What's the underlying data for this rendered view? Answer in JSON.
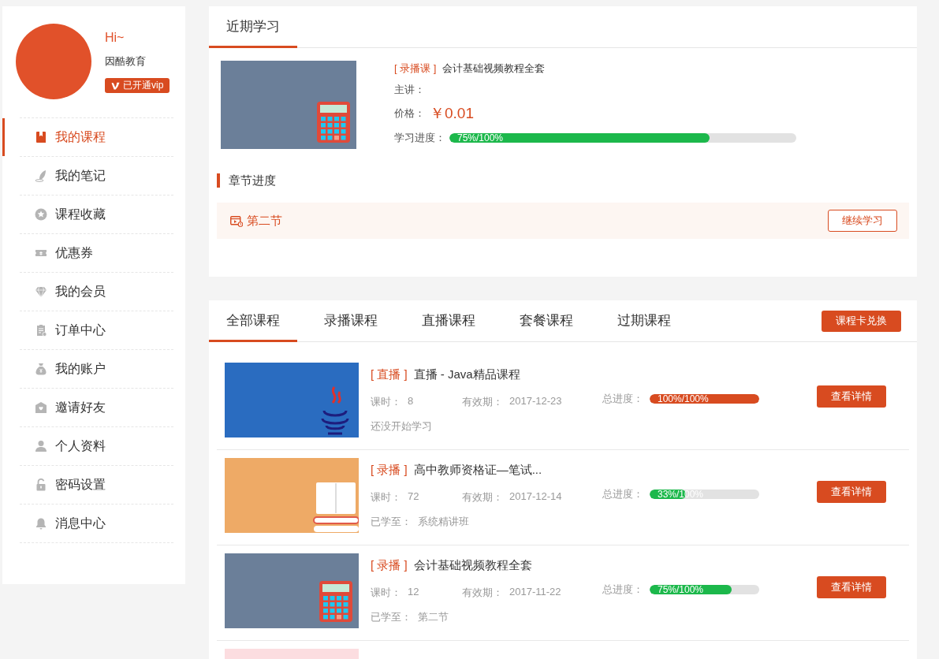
{
  "sidebar": {
    "greeting": "Hi~",
    "username": "因酷教育",
    "vip_badge": "已开通vip",
    "items": [
      {
        "label": "我的课程",
        "selected": true
      },
      {
        "label": "我的笔记",
        "selected": false
      },
      {
        "label": "课程收藏",
        "selected": false
      },
      {
        "label": "优惠券",
        "selected": false
      },
      {
        "label": "我的会员",
        "selected": false
      },
      {
        "label": "订单中心",
        "selected": false
      },
      {
        "label": "我的账户",
        "selected": false
      },
      {
        "label": "邀请好友",
        "selected": false
      },
      {
        "label": "个人资料",
        "selected": false
      },
      {
        "label": "密码设置",
        "selected": false
      },
      {
        "label": "消息中心",
        "selected": false
      }
    ]
  },
  "recent": {
    "tab": {
      "label": "近期学习",
      "selected": true
    },
    "course": {
      "cover": {
        "kind": "calculator"
      },
      "tag": "[ 录播课 ]",
      "title": "会计基础视频教程全套",
      "lecturer_label": "主讲：",
      "price_label": "价格：",
      "price": "￥0.01",
      "progress_label": "学习进度：",
      "progress": {
        "level": 0.75,
        "reading": "75%/100%"
      }
    },
    "chapter_heading": "章节进度",
    "chapter": {
      "name": "第二节",
      "button": "继续学习"
    }
  },
  "courses": {
    "tabs": [
      {
        "label": "全部课程",
        "selected": true
      },
      {
        "label": "录播课程",
        "selected": false
      },
      {
        "label": "直播课程",
        "selected": false
      },
      {
        "label": "套餐课程",
        "selected": false
      },
      {
        "label": "过期课程",
        "selected": false
      }
    ],
    "redeem_button": "课程卡兑换",
    "items": [
      {
        "cover": {
          "kind": "java"
        },
        "tag": "[ 直播 ]",
        "title": "直播 - Java精品课程",
        "hours_label": "课时：",
        "hours": "8",
        "expiry_label": "有效期：",
        "expiry": "2017-12-23",
        "status": "还没开始学习",
        "progress_label": "总进度：",
        "progress": {
          "level": 1,
          "reading": "100%/100%",
          "color": "#d84b20"
        },
        "button": "查看详情"
      },
      {
        "cover": {
          "kind": "book"
        },
        "tag": "[ 录播 ]",
        "title": "高中教师资格证—笔试...",
        "hours_label": "课时：",
        "hours": "72",
        "expiry_label": "有效期：",
        "expiry": "2017-12-14",
        "studied_label": "已学至：",
        "studied": "系统精讲班",
        "progress_label": "总进度：",
        "progress": {
          "level": 0.33,
          "reading": "33%/100%",
          "color": "#1cb84b"
        },
        "button": "查看详情"
      },
      {
        "cover": {
          "kind": "calculator"
        },
        "tag": "[ 录播 ]",
        "title": "会计基础视频教程全套",
        "hours_label": "课时：",
        "hours": "12",
        "expiry_label": "有效期：",
        "expiry": "2017-11-22",
        "studied_label": "已学至：",
        "studied": "第二节",
        "progress_label": "总进度：",
        "progress": {
          "level": 0.75,
          "reading": "75%/100%",
          "color": "#1cb84b"
        },
        "button": "查看详情"
      },
      {
        "cover": {
          "kind": "banner"
        }
      }
    ]
  }
}
